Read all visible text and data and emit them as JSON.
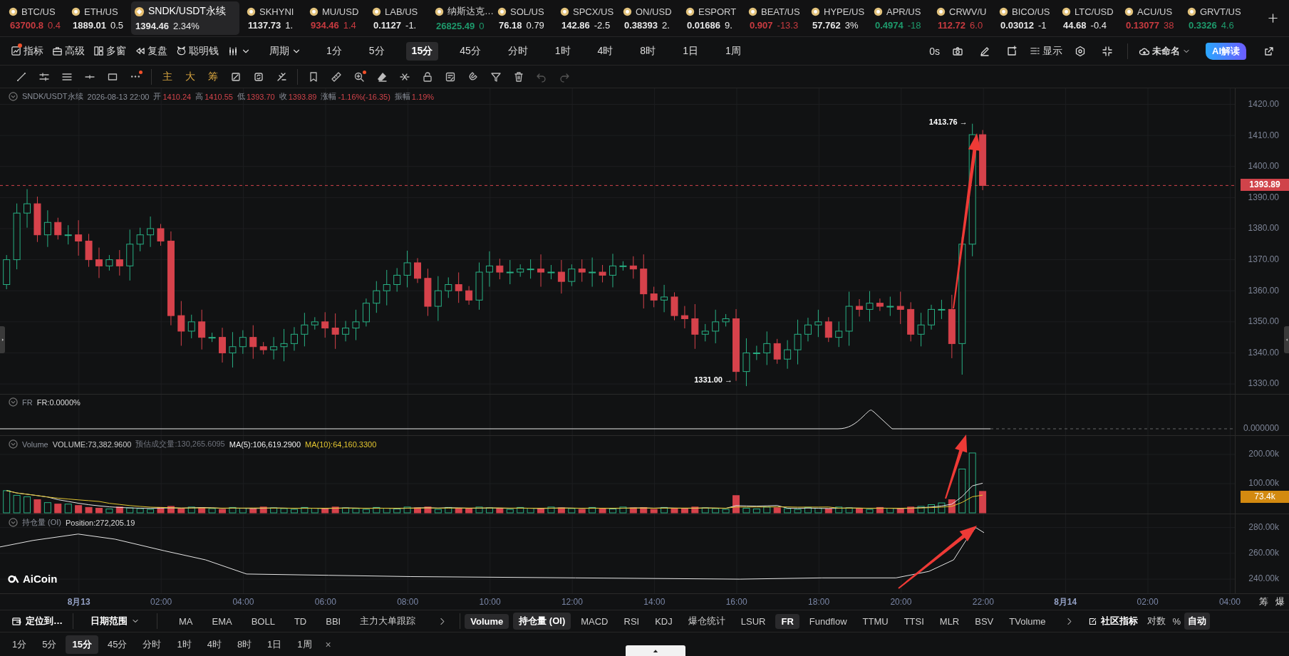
{
  "tickers": [
    {
      "symbol": "BTC/US",
      "price": "63700.8",
      "change": "0.4",
      "color": "#c93b40",
      "selected": false
    },
    {
      "symbol": "ETH/US",
      "price": "1889.01",
      "change": "0.5",
      "color": "#e8e8e8",
      "selected": false
    },
    {
      "symbol": "SNDK/USDT永续",
      "price": "1394.46",
      "change": "2.34%",
      "color": "#e8e8e8",
      "selected": true
    },
    {
      "symbol": "SKHYNI",
      "price": "1137.73",
      "change": "1.",
      "color": "#e8e8e8",
      "selected": false
    },
    {
      "symbol": "MU/USD",
      "price": "934.46",
      "change": "1.4",
      "color": "#c93b40",
      "selected": false
    },
    {
      "symbol": "LAB/US",
      "price": "0.1127",
      "change": "-1.",
      "color": "#e8e8e8",
      "selected": false
    },
    {
      "symbol": "纳斯达克…",
      "price": "26825.49",
      "change": "0",
      "color": "#1e9a6c",
      "selected": false
    },
    {
      "symbol": "SOL/US",
      "price": "76.18",
      "change": "0.79",
      "color": "#e8e8e8",
      "selected": false
    },
    {
      "symbol": "SPCX/US",
      "price": "142.86",
      "change": "-2.5",
      "color": "#e8e8e8",
      "selected": false
    },
    {
      "symbol": "ON/USD",
      "price": "0.38393",
      "change": "2.",
      "color": "#e8e8e8",
      "selected": false
    },
    {
      "symbol": "ESPORT",
      "price": "0.01686",
      "change": "9.",
      "color": "#e8e8e8",
      "selected": false
    },
    {
      "symbol": "BEAT/US",
      "price": "0.907",
      "change": "-13.3",
      "color": "#c93b40",
      "selected": false
    },
    {
      "symbol": "HYPE/US",
      "price": "57.762",
      "change": "3%",
      "color": "#e8e8e8",
      "selected": false
    },
    {
      "symbol": "APR/US",
      "price": "0.4974",
      "change": "-18",
      "color": "#1e9a6c",
      "selected": false
    },
    {
      "symbol": "CRWV/U",
      "price": "112.72",
      "change": "6.0",
      "color": "#c93b40",
      "selected": false
    },
    {
      "symbol": "BICO/US",
      "price": "0.03012",
      "change": "-1",
      "color": "#e8e8e8",
      "selected": false
    },
    {
      "symbol": "LTC/USD",
      "price": "44.68",
      "change": "-0.4",
      "color": "#e8e8e8",
      "selected": false
    },
    {
      "symbol": "ACU/US",
      "price": "0.13077",
      "change": "38",
      "color": "#c93b40",
      "selected": false
    },
    {
      "symbol": "GRVT/US",
      "price": "0.3326",
      "change": "4.6",
      "color": "#1e9a6c",
      "selected": false
    }
  ],
  "main_toolbar": {
    "tools": [
      {
        "kind": "indicator",
        "label": "指标",
        "dot": true
      },
      {
        "kind": "briefcase",
        "label": "高级",
        "dot": false
      },
      {
        "kind": "grid",
        "label": "多窗",
        "dot": false
      },
      {
        "kind": "rewind",
        "label": "复盘",
        "dot": false
      },
      {
        "kind": "smart",
        "label": "聪明钱",
        "dot": false
      }
    ],
    "period_menu": "周期",
    "periods": [
      {
        "label": "1分",
        "selected": false
      },
      {
        "label": "5分",
        "selected": false
      },
      {
        "label": "15分",
        "selected": true
      },
      {
        "label": "45分",
        "selected": false
      },
      {
        "label": "分时",
        "selected": false
      },
      {
        "label": "1时",
        "selected": false
      },
      {
        "label": "4时",
        "selected": false
      },
      {
        "label": "8时",
        "selected": false
      },
      {
        "label": "1日",
        "selected": false
      },
      {
        "label": "1周",
        "selected": false
      }
    ],
    "timer": "0s",
    "display_menu": "显示",
    "layout_name": "未命名",
    "ai_button": "AI解读"
  },
  "drawing_toolbar": {
    "text_tools": [
      {
        "label": "主"
      },
      {
        "label": "大"
      },
      {
        "label": "筹"
      }
    ],
    "history": [
      {
        "kind": "undo",
        "disabled": true
      },
      {
        "kind": "redo",
        "disabled": true
      }
    ]
  },
  "price_pane": {
    "symbol": "SNDK/USDT永续",
    "time": "2026-08-13 22:00",
    "ohlc": [
      {
        "label": "开",
        "value": "1410.24"
      },
      {
        "label": "高",
        "value": "1410.55"
      },
      {
        "label": "低",
        "value": "1393.70"
      },
      {
        "label": "收",
        "value": "1393.89"
      },
      {
        "label": "涨幅",
        "value": "-1.16%(-16.35)"
      },
      {
        "label": "振幅",
        "value": "1.19%"
      }
    ],
    "high_marker": "1413.76 →",
    "low_marker": "1331.00 →",
    "y_labels": [
      "1420.00",
      "1410.00",
      "1400.00",
      "1390.00",
      "1380.00",
      "1370.00",
      "1360.00",
      "1350.00",
      "1340.00",
      "1330.00"
    ],
    "last_price": "1393.89"
  },
  "fr_pane": {
    "title": "FR",
    "reading": "FR:0.0000%",
    "y_labels": [
      "0.000000"
    ]
  },
  "volume_pane": {
    "title": "Volume",
    "readings": [
      {
        "kind": "volume",
        "text": "VOLUME:73,382.9600"
      },
      {
        "kind": "estimate",
        "text": "预估成交量:130,265.6095"
      },
      {
        "kind": "ma5",
        "text": "MA(5):106,619.2900"
      },
      {
        "kind": "ma10",
        "text": "MA(10):64,160.3300"
      }
    ],
    "y_labels": [
      "200.00k",
      "100.00k"
    ],
    "last_volume": "73.4k"
  },
  "oi_pane": {
    "title": "持仓量 (OI)",
    "reading": "Position:272,205.19",
    "y_labels": [
      "280.00k",
      "260.00k",
      "240.00k"
    ],
    "logo": "AiCoin"
  },
  "time_axis": {
    "labels": [
      {
        "text": "8月13",
        "kind": "date"
      },
      {
        "text": "02:00",
        "kind": "time"
      },
      {
        "text": "04:00",
        "kind": "time"
      },
      {
        "text": "06:00",
        "kind": "time"
      },
      {
        "text": "08:00",
        "kind": "time"
      },
      {
        "text": "10:00",
        "kind": "time"
      },
      {
        "text": "12:00",
        "kind": "time"
      },
      {
        "text": "14:00",
        "kind": "time"
      },
      {
        "text": "16:00",
        "kind": "time"
      },
      {
        "text": "18:00",
        "kind": "time"
      },
      {
        "text": "20:00",
        "kind": "time"
      },
      {
        "text": "22:00",
        "kind": "time"
      },
      {
        "text": "8月14",
        "kind": "date"
      },
      {
        "text": "02:00",
        "kind": "time"
      },
      {
        "text": "04:00",
        "kind": "time"
      }
    ],
    "corner": [
      "筹",
      "爆"
    ]
  },
  "bottom_bar": {
    "locate": "定位到…",
    "date_range": "日期范围",
    "main_indicators": [
      "MA",
      "EMA",
      "BOLL",
      "TD",
      "BBI",
      "主力大单跟踪"
    ],
    "sub_indicators": [
      {
        "label": "Volume",
        "selected": true
      },
      {
        "label": "持仓量 (OI)",
        "selected": true
      },
      {
        "label": "MACD",
        "selected": false
      },
      {
        "label": "RSI",
        "selected": false
      },
      {
        "label": "KDJ",
        "selected": false
      },
      {
        "label": "爆仓统计",
        "selected": false
      },
      {
        "label": "LSUR",
        "selected": false
      },
      {
        "label": "FR",
        "selected": true
      },
      {
        "label": "Fundflow",
        "selected": false
      },
      {
        "label": "TTMU",
        "selected": false
      },
      {
        "label": "TTSI",
        "selected": false
      },
      {
        "label": "MLR",
        "selected": false
      },
      {
        "label": "BSV",
        "selected": false
      },
      {
        "label": "TVolume",
        "selected": false
      }
    ],
    "community": "社区指标",
    "scale_options": [
      {
        "label": "对数",
        "selected": false
      },
      {
        "label": "%",
        "selected": false
      },
      {
        "label": "自动",
        "selected": true
      }
    ],
    "periods": [
      {
        "label": "1分",
        "selected": false
      },
      {
        "label": "5分",
        "selected": false
      },
      {
        "label": "15分",
        "selected": true
      },
      {
        "label": "45分",
        "selected": false
      },
      {
        "label": "分时",
        "selected": false
      },
      {
        "label": "1时",
        "selected": false
      },
      {
        "label": "4时",
        "selected": false
      },
      {
        "label": "8时",
        "selected": false
      },
      {
        "label": "1日",
        "selected": false
      },
      {
        "label": "1周",
        "selected": false
      }
    ],
    "close": "×"
  }
}
